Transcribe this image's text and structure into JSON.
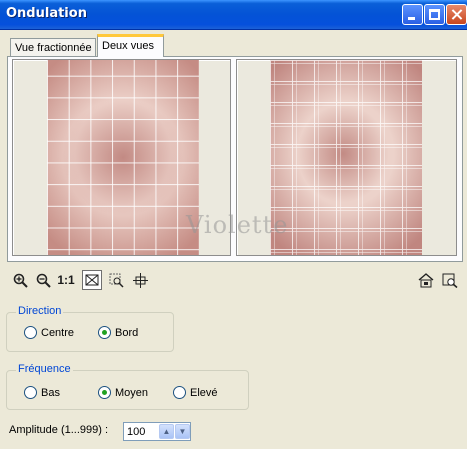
{
  "window": {
    "title": "Ondulation"
  },
  "tabs": [
    {
      "label": "Vue fractionnée",
      "active": false
    },
    {
      "label": "Deux vues",
      "active": true
    }
  ],
  "preview": {
    "watermark": "Violette"
  },
  "toolbar": {
    "zoom_in_icon": "zoom-in-icon",
    "zoom_out_icon": "zoom-out-icon",
    "actual_size_label": "1:1",
    "fit_icon": "fit-window-icon",
    "zoom_box_icon": "zoom-box-icon",
    "pan_icon": "pan-icon",
    "navigator_icon": "navigator-icon",
    "preview_icon": "preview-zoom-icon"
  },
  "direction": {
    "legend": "Direction",
    "options": [
      {
        "label": "Centre",
        "selected": false
      },
      {
        "label": "Bord",
        "selected": true
      }
    ]
  },
  "frequence": {
    "legend": "Fréquence",
    "options": [
      {
        "label": "Bas",
        "selected": false
      },
      {
        "label": "Moyen",
        "selected": true
      },
      {
        "label": "Elevé",
        "selected": false
      }
    ]
  },
  "amplitude": {
    "label": "Amplitude (1...999) :",
    "value": "100"
  },
  "colors": {
    "accent": "#0046d5",
    "titlebar": "#0453d6",
    "radio_on": "#21a121"
  }
}
